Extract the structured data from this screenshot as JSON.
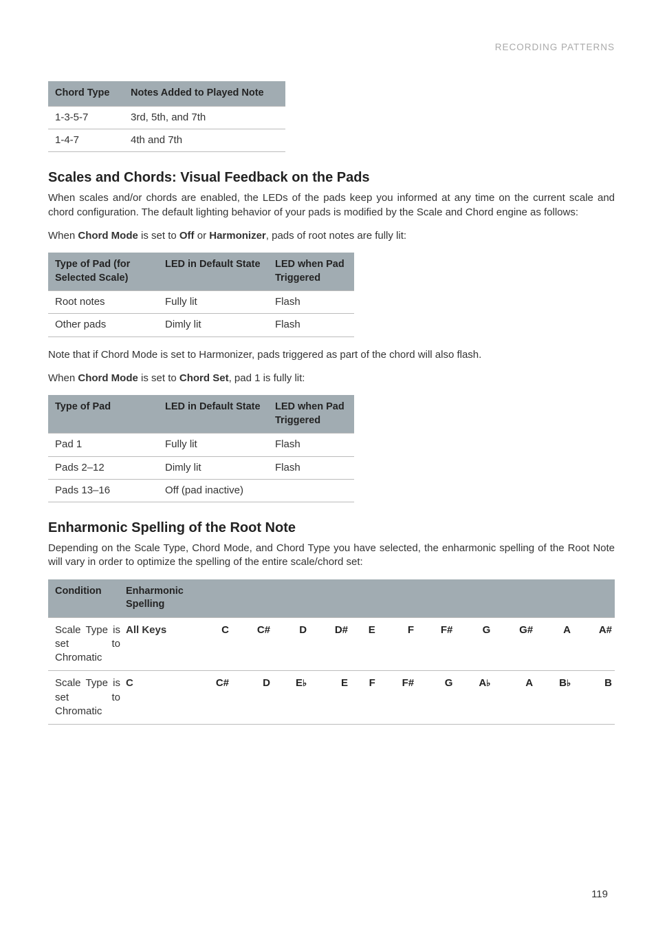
{
  "header": "RECORDING PATTERNS",
  "page_number": "119",
  "table1": {
    "headers": [
      "Chord Type",
      "Notes Added to Played Note"
    ],
    "rows": [
      [
        "1-3-5-7",
        "3rd, 5th, and 7th"
      ],
      [
        "1-4-7",
        "4th and 7th"
      ]
    ]
  },
  "section1": {
    "title": "Scales and Chords: Visual Feedback on the Pads",
    "para1": "When scales and/or chords are enabled, the LEDs of the pads keep you informed at any time on the current scale and chord configuration. The default lighting behavior of your pads is modified by the Scale and Chord engine as follows:",
    "para2_pre": "When ",
    "para2_b1": "Chord Mode",
    "para2_mid": " is set to ",
    "para2_b2": "Off",
    "para2_or": " or ",
    "para2_b3": "Harmonizer",
    "para2_post": ", pads of root notes are fully lit:"
  },
  "table2": {
    "headers": [
      "Type of Pad (for Selected Scale)",
      "LED in Default State",
      "LED when Pad Triggered"
    ],
    "rows": [
      [
        "Root notes",
        "Fully lit",
        "Flash"
      ],
      [
        "Other pads",
        "Dimly lit",
        "Flash"
      ]
    ]
  },
  "midnote": "Note that if Chord Mode is set to Harmonizer, pads triggered as part of the chord will also flash.",
  "para3_pre": "When ",
  "para3_b1": "Chord Mode",
  "para3_mid": " is set to ",
  "para3_b2": "Chord Set",
  "para3_post": ", pad 1 is fully lit:",
  "table3": {
    "headers": [
      "Type of Pad",
      "LED in Default State",
      "LED when Pad Triggered"
    ],
    "rows": [
      [
        "Pad 1",
        "Fully lit",
        "Flash"
      ],
      [
        "Pads 2–12",
        "Dimly lit",
        "Flash"
      ],
      [
        "Pads 13–16",
        "Off (pad inactive)",
        ""
      ]
    ]
  },
  "section2": {
    "title": "Enharmonic Spelling of the Root Note",
    "para": "Depending on the Scale Type, Chord Mode, and Chord Type you have selected, the enharmonic spelling of the Root Note will vary in order to optimize the spelling of the entire scale/chord set:"
  },
  "table4": {
    "headers": [
      "Condition",
      "Enharmonic Spelling"
    ],
    "rows": [
      {
        "condition": "Scale Type is set to Chromatic",
        "spelling": "All Keys",
        "notes": [
          "C",
          "C#",
          "D",
          "D#",
          "E",
          "F",
          "F#",
          "G",
          "G#",
          "A",
          "A#"
        ]
      },
      {
        "condition": "Scale Type is set to Chromatic",
        "spelling": "C",
        "notes": [
          "C#",
          "D",
          "E♭",
          "E",
          "F",
          "F#",
          "G",
          "A♭",
          "A",
          "B♭",
          "B"
        ]
      }
    ]
  }
}
